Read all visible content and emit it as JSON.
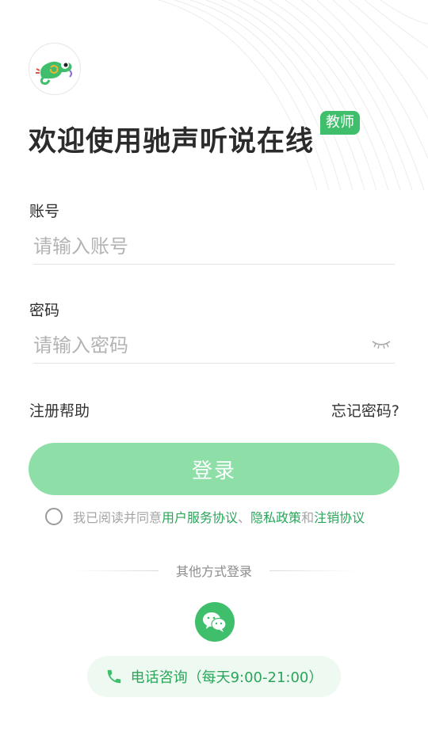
{
  "header": {
    "title": "欢迎使用驰声听说在线",
    "role_badge": "教师"
  },
  "form": {
    "account_label": "账号",
    "account_placeholder": "请输入账号",
    "account_value": "",
    "password_label": "密码",
    "password_placeholder": "请输入密码",
    "password_value": ""
  },
  "links": {
    "register_help": "注册帮助",
    "forgot_password": "忘记密码?"
  },
  "login_button": "登录",
  "agreement": {
    "prefix": "我已阅读并同意",
    "user_service": "用户服务协议",
    "sep": "、",
    "privacy": "隐私政策",
    "and": "和",
    "cancel": "注销协议",
    "checked": false
  },
  "other_login": {
    "label": "其他方式登录",
    "wechat_icon": "wechat-icon"
  },
  "phone_consult": {
    "text": "电话咨询（每天9:00-21:00）",
    "icon": "phone-icon"
  },
  "colors": {
    "accent": "#3fbf6c",
    "button_disabled": "#8ddfa7",
    "link": "#2aa55a",
    "pill_bg": "#eef9f1"
  }
}
